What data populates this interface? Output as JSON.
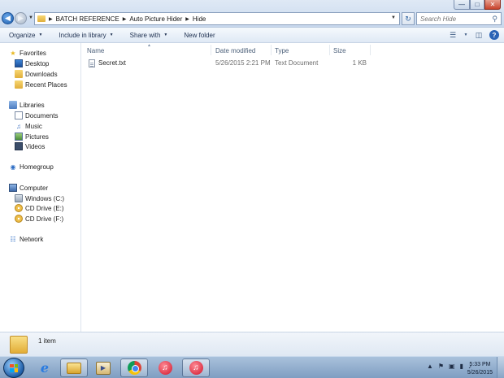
{
  "address_bar": {
    "crumbs": [
      "BATCH REFERENCE",
      "Auto Picture Hider",
      "Hide"
    ]
  },
  "search": {
    "placeholder": "Search Hide"
  },
  "toolbar": {
    "organize": "Organize",
    "include_in_library": "Include in library",
    "share_with": "Share with",
    "new_folder": "New folder"
  },
  "navigation": {
    "favorites": {
      "label": "Favorites",
      "items": [
        "Desktop",
        "Downloads",
        "Recent Places"
      ]
    },
    "libraries": {
      "label": "Libraries",
      "items": [
        "Documents",
        "Music",
        "Pictures",
        "Videos"
      ]
    },
    "homegroup": "Homegroup",
    "computer": {
      "label": "Computer",
      "items": [
        "Windows (C:)",
        "CD Drive (E:)",
        "CD Drive (F:)"
      ]
    },
    "network": "Network"
  },
  "columns": {
    "name": "Name",
    "date_modified": "Date modified",
    "type": "Type",
    "size": "Size"
  },
  "files": [
    {
      "name": "Secret.txt",
      "date_modified": "5/26/2015 2:21 PM",
      "type": "Text Document",
      "size": "1 KB"
    }
  ],
  "details": {
    "item_count": "1 item"
  },
  "taskbar": {
    "time": "5:33 PM",
    "date": "5/26/2015"
  }
}
